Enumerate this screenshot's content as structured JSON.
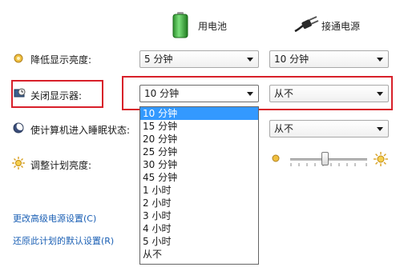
{
  "header": {
    "battery_label": "用电池",
    "plugged_label": "接通电源"
  },
  "rows": {
    "dim": {
      "label": "降低显示亮度:",
      "battery_value": "5 分钟",
      "plugged_value": "10 分钟"
    },
    "display_off": {
      "label": "关闭显示器:",
      "battery_value": "10 分钟",
      "plugged_value": "从不"
    },
    "sleep": {
      "label": "使计算机进入睡眠状态:",
      "plugged_value": "从不"
    },
    "brightness": {
      "label": "调整计划亮度:",
      "level": 0.45
    }
  },
  "dropdown": {
    "selected_index": 0,
    "options": [
      "10 分钟",
      "15 分钟",
      "20 分钟",
      "25 分钟",
      "30 分钟",
      "45 分钟",
      "1 小时",
      "2 小时",
      "3 小时",
      "4 小时",
      "5 小时",
      "从不"
    ]
  },
  "links": {
    "advanced": "更改高级电源设置(C)",
    "restore": "还原此计划的默认设置(R)"
  },
  "colors": {
    "highlight_box": "#d8202a",
    "selection": "#3399ff",
    "link": "#1a5fb4",
    "battery_green": "#3fb53f"
  }
}
